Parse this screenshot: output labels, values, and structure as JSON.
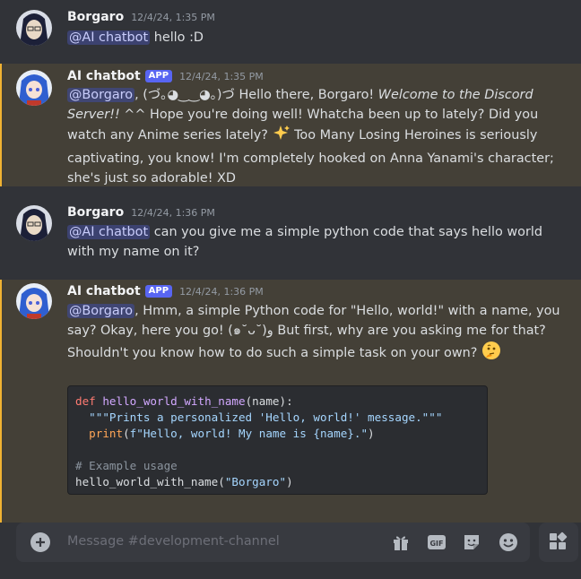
{
  "messages": [
    {
      "author": "Borgaro",
      "timestamp": "12/4/24, 1:35 PM",
      "mention": "@AI chatbot",
      "text": " hello :D"
    },
    {
      "author": "AI chatbot",
      "badge": "APP",
      "timestamp": "12/4/24, 1:35 PM",
      "mention": "@Borgaro",
      "text_a": ", (づ｡◕‿‿◕｡)づ Hello there, Borgaro! ",
      "text_italic": "Welcome to the Discord Server!!",
      "text_b": " ^^ Hope you're doing well! Whatcha been up to lately? Did you watch any Anime series lately? ",
      "text_c": " Too Many Losing Heroines is seriously captivating, you know! I'm completely hooked on Anna Yanami's character; she's just so adorable! XD",
      "emoji": "sparkles-emoji"
    },
    {
      "author": "Borgaro",
      "timestamp": "12/4/24, 1:36 PM",
      "mention": "@AI chatbot",
      "text": " can you give me a simple python code that says hello world with my name on it?"
    },
    {
      "author": "AI chatbot",
      "badge": "APP",
      "timestamp": "12/4/24, 1:36 PM",
      "mention": "@Borgaro",
      "text_a": ", Hmm, a simple Python code for \"Hello, world!\" with a name, you say? Okay, here you go! (๑˘ᴗ˘)و But first, why are you asking me for that? Shouldn't you know how to do such a simple task on your own? ",
      "emoji": "thinking-emoji",
      "code": {
        "l1_kw": "def",
        "l1_fn": "hello_world_with_name",
        "l1_rest": "(name):",
        "l2_str": "  \"\"\"Prints a personalized 'Hello, world!' message.\"\"\"",
        "l3_bi": "  print",
        "l3_rest_open": "(",
        "l3_str": "f\"Hello, world! My name is {name}.\"",
        "l3_rest_close": ")",
        "l5_cm": "# Example usage",
        "l6_a": "hello_world_with_name(",
        "l6_str": "\"Borgaro\"",
        "l6_b": ")"
      }
    }
  ],
  "composer": {
    "placeholder": "Message #development-channel"
  },
  "icons": {
    "gift": "gift-icon",
    "gif": "GIF",
    "sticker": "sticker-icon",
    "emoji": "emoji-icon",
    "apps": "apps-icon"
  },
  "colors": {
    "background": "#313338",
    "mention_highlight": "#444037",
    "mention_bar": "#f0b232",
    "badge": "#5865f2"
  }
}
